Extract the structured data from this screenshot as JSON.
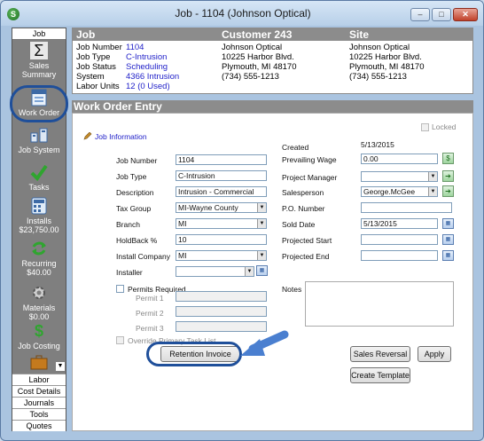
{
  "window": {
    "title": "Job - 1104 (Johnson Optical)",
    "app_icon": "S",
    "controls": [
      "minimize-icon",
      "maximize-icon",
      "close-icon"
    ]
  },
  "nav": {
    "header": "Job",
    "items": [
      {
        "label": "Sales Summary",
        "icon": "sigma-icon"
      },
      {
        "label": "Work Order",
        "icon": "work-order-icon"
      },
      {
        "label": "Job System",
        "icon": "job-system-icon"
      },
      {
        "label": "Tasks",
        "icon": "checkmark-icon"
      },
      {
        "label": "Installs",
        "sub": "$23,750.00",
        "icon": "calculator-icon"
      },
      {
        "label": "Recurring",
        "sub": "$40.00",
        "icon": "recurring-icon"
      },
      {
        "label": "Materials",
        "sub": "$0.00",
        "icon": "gear-icon"
      },
      {
        "label": "Job Costing",
        "icon": "dollar-icon"
      }
    ],
    "bottom": [
      "Labor",
      "Cost Details",
      "Journals",
      "Tools",
      "Quotes"
    ]
  },
  "header": {
    "job": {
      "title": "Job",
      "rows": [
        {
          "label": "Job Number",
          "value": "1104"
        },
        {
          "label": "Job Type",
          "value": "C-Intrusion"
        },
        {
          "label": "Job Status",
          "value": "Scheduling"
        },
        {
          "label": "System",
          "value": "4366 Intrusion"
        },
        {
          "label": "Labor Units",
          "value": "12 (0 Used)"
        }
      ]
    },
    "customer": {
      "title": "Customer 243",
      "lines": [
        "Johnson Optical",
        "10225 Harbor Blvd.",
        "Plymouth, MI 48170",
        "(734) 555-1213"
      ]
    },
    "site": {
      "title": "Site",
      "lines": [
        "Johnson Optical",
        "10225 Harbor Blvd.",
        "Plymouth, MI 48170",
        "(734) 555-1213"
      ]
    }
  },
  "work_order": {
    "section_title": "Work Order Entry",
    "locked_label": "Locked",
    "job_info_label": "Job Information",
    "left": {
      "job_number": {
        "label": "Job Number",
        "value": "1104"
      },
      "job_type": {
        "label": "Job Type",
        "value": "C-Intrusion"
      },
      "description": {
        "label": "Description",
        "value": "Intrusion - Commercial"
      },
      "tax_group": {
        "label": "Tax Group",
        "value": "MI-Wayne County"
      },
      "branch": {
        "label": "Branch",
        "value": "MI"
      },
      "holdback": {
        "label": "HoldBack  %",
        "value": "10"
      },
      "install_company": {
        "label": "Install Company",
        "value": "MI"
      },
      "installer": {
        "label": "Installer",
        "value": ""
      }
    },
    "right": {
      "created": {
        "label": "Created",
        "value": "5/13/2015"
      },
      "prevailing_wage": {
        "label": "Prevailing Wage",
        "value": "0.00"
      },
      "project_manager": {
        "label": "Project Manager",
        "value": ""
      },
      "salesperson": {
        "label": "Salesperson",
        "value": "George.McGee"
      },
      "po_number": {
        "label": "P.O. Number",
        "value": ""
      },
      "sold_date": {
        "label": "Sold Date",
        "value": "5/13/2015"
      },
      "projected_start": {
        "label": "Projected Start",
        "value": ""
      },
      "projected_end": {
        "label": "Projected End",
        "value": ""
      }
    },
    "permits_required": "Permits Required",
    "permits": [
      "Permit 1",
      "Permit 2",
      "Permit 3"
    ],
    "override_label": "Override Primary Task List",
    "notes_label": "Notes",
    "buttons": {
      "retention_invoice": "Retention Invoice",
      "sales_reversal": "Sales Reversal",
      "apply": "Apply",
      "create_template": "Create Template"
    }
  },
  "colors": {
    "highlight": "#1f4f9a",
    "arrow": "#4a7fd0",
    "link": "#1e1ec8",
    "nav_bg": "#7f7f7f",
    "bar_bg": "#8c8c8c"
  }
}
